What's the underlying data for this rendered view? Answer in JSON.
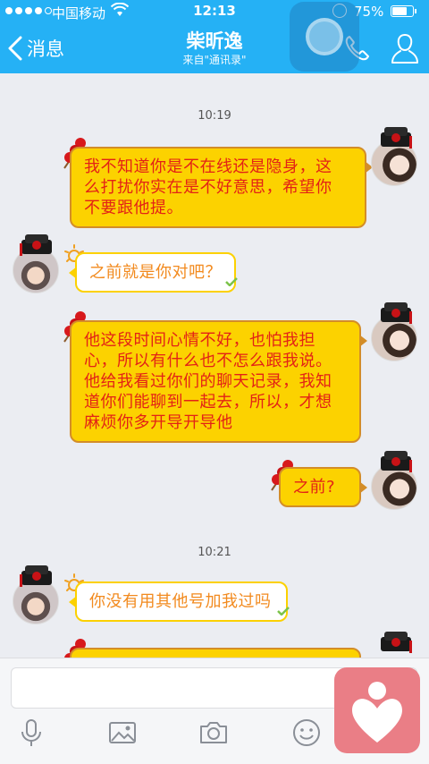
{
  "status_bar": {
    "carrier": "中国移动",
    "time": "12:13",
    "battery_text": "75%",
    "battery_level": 0.75
  },
  "header": {
    "back_label": "消息",
    "title": "柴昕逸",
    "subtitle": "来自\"通讯录\"",
    "background_color": "#25b1f5"
  },
  "messages": [
    {
      "type": "time",
      "text": "10:19"
    },
    {
      "type": "message",
      "side": "right",
      "text": "我不知道你是不在线还是隐身，这么打扰你实在是不好意思，希望你不要跟他提。",
      "lines": [
        "我不知道你是不在线还是隐身，这",
        "么打扰你实在是不好意思，希望你",
        "不要跟他提。"
      ]
    },
    {
      "type": "message",
      "side": "left",
      "text": "之前就是你对吧？",
      "lines": [
        "之前就是你对吧？"
      ]
    },
    {
      "type": "message",
      "side": "right",
      "text": "他这段时间心情不好，也怕我担心，所以有什么也不怎么跟我说。他给我看过你们的聊天记录，我知道你们能聊到一起去，所以，才想麻烦你多开导开导他",
      "lines": [
        "他这段时间心情不好，也怕我担",
        "心，所以有什么也不怎么跟我说。",
        "他给我看过你们的聊天记录，我知",
        "道你们能聊到一起去，所以，才想",
        "麻烦你多开导开导他"
      ]
    },
    {
      "type": "message",
      "side": "right",
      "text": "之前?",
      "lines": [
        "之前?"
      ]
    },
    {
      "type": "time",
      "text": "10:21"
    },
    {
      "type": "message",
      "side": "left",
      "text": "你没有用其他号加我过吗",
      "lines": [
        "你没有用其他号加我过吗"
      ]
    }
  ],
  "colors": {
    "bubble_fill": "#fcd200",
    "bubble_text": "#e32216",
    "incoming_text": "#f28a1e",
    "favorite_badge": "#ea7e86"
  },
  "icons": {
    "back": "chevron-left-icon",
    "phone": "phone-icon",
    "profile": "person-icon",
    "voice": "microphone-icon",
    "image": "picture-icon",
    "camera": "camera-icon",
    "emoji": "smiley-icon",
    "favorite": "heart-icon"
  }
}
